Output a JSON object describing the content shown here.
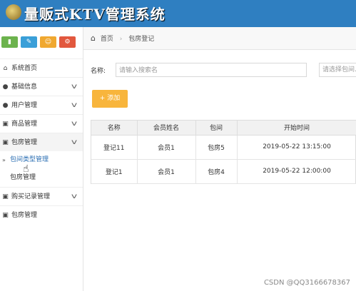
{
  "app": {
    "title": "量贩式KTV管理系统"
  },
  "sidebar": {
    "toolbar": [
      {
        "icon": "chart-icon",
        "glyph": "▮"
      },
      {
        "icon": "pencil-icon",
        "glyph": "✎"
      },
      {
        "icon": "users-icon",
        "glyph": "☺"
      },
      {
        "icon": "gears-icon",
        "glyph": "⚙"
      }
    ],
    "items": [
      {
        "label": "系统首页",
        "icon": "home-icon",
        "glyph": "⌂",
        "expandable": false
      },
      {
        "label": "基础信息",
        "icon": "user-icon",
        "glyph": "●",
        "expandable": true
      },
      {
        "label": "用户管理",
        "icon": "user-icon",
        "glyph": "●",
        "expandable": true
      },
      {
        "label": "商品管理",
        "icon": "image-icon",
        "glyph": "▣",
        "expandable": true
      },
      {
        "label": "包房管理",
        "icon": "image-icon",
        "glyph": "▣",
        "expandable": true,
        "expanded": true
      },
      {
        "label": "购买记录管理",
        "icon": "image-icon",
        "glyph": "▣",
        "expandable": true
      },
      {
        "label": "包房管理",
        "icon": "image-icon",
        "glyph": "▣",
        "expandable": true
      }
    ],
    "subitems": [
      {
        "label": "包间类型管理",
        "active": true
      },
      {
        "label": "包房管理",
        "active": false
      }
    ]
  },
  "breadcrumb": {
    "home": "首页",
    "current": "包房登记"
  },
  "search": {
    "label": "名称:",
    "placeholder": "请输入搜索名",
    "select_placeholder": "请选择包间..."
  },
  "actions": {
    "add_label": "+ 添加"
  },
  "table": {
    "columns": [
      "名称",
      "会员姓名",
      "包间",
      "开始时间"
    ],
    "rows": [
      [
        "登记11",
        "会员1",
        "包房5",
        "2019-05-22 13:15:00"
      ],
      [
        "登记1",
        "会员1",
        "包房4",
        "2019-05-22 12:00:00"
      ]
    ]
  },
  "watermark": "CSDN @QQ3166678367"
}
